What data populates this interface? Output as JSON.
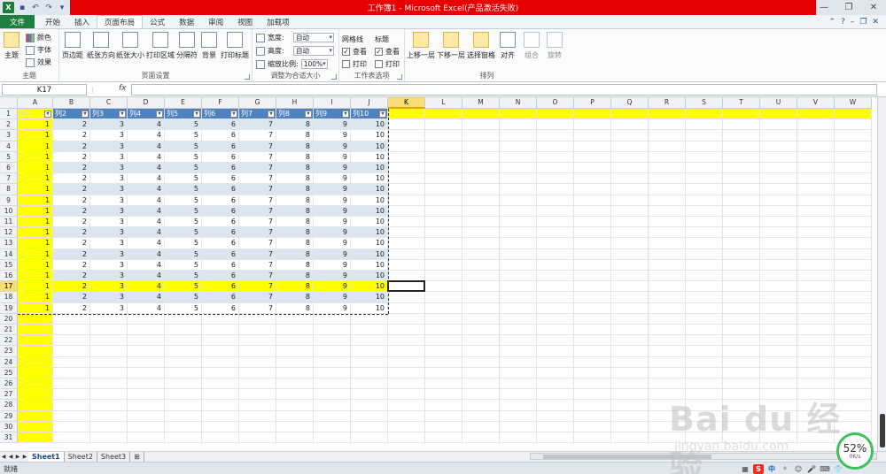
{
  "window": {
    "title": "工作簿1 - Microsoft Excel(产品激活失败)",
    "controls": [
      "—",
      "❐",
      "✕"
    ]
  },
  "quick_access": [
    "save-icon",
    "undo-icon",
    "redo-icon",
    "customize-icon"
  ],
  "tabs": [
    {
      "label": "文件",
      "kind": "file"
    },
    {
      "label": "开始"
    },
    {
      "label": "插入"
    },
    {
      "label": "页面布局",
      "active": true
    },
    {
      "label": "公式"
    },
    {
      "label": "数据"
    },
    {
      "label": "审阅"
    },
    {
      "label": "视图"
    },
    {
      "label": "加载项"
    }
  ],
  "ribbon": {
    "theme_group": {
      "label": "主题",
      "themes_btn": "主题",
      "colors": "颜色",
      "fonts": "字体",
      "effects": "效果"
    },
    "page_setup_group": {
      "label": "页面设置",
      "buttons": [
        "页边距",
        "纸张方向",
        "纸张大小",
        "打印区域",
        "分隔符",
        "背景",
        "打印标题"
      ]
    },
    "scale_group": {
      "label": "调整为合适大小",
      "width_label": "宽度:",
      "width_value": "自动",
      "height_label": "高度:",
      "height_value": "自动",
      "scale_label": "缩放比例:",
      "scale_value": "100%"
    },
    "sheet_options_group": {
      "label": "工作表选项",
      "gridlines_title": "网格线",
      "headings_title": "标题",
      "view": "查看",
      "print": "打印",
      "gridlines_view": true,
      "gridlines_print": false,
      "headings_view": true,
      "headings_print": false
    },
    "arrange_group": {
      "label": "排列",
      "buttons": [
        "上移一层",
        "下移一层",
        "选择窗格",
        "对齐",
        "组合",
        "旋转"
      ]
    }
  },
  "formula_bar": {
    "name_box": "K17",
    "fx": "fx",
    "value": ""
  },
  "grid": {
    "columns": [
      "A",
      "B",
      "C",
      "D",
      "E",
      "F",
      "G",
      "H",
      "I",
      "J",
      "K",
      "L",
      "M",
      "N",
      "O",
      "P",
      "Q",
      "R",
      "S",
      "T",
      "U",
      "V",
      "W"
    ],
    "active_column": "K",
    "active_row": 17,
    "header_row": [
      "列1",
      "列2",
      "列3",
      "列4",
      "列5",
      "列6",
      "列7",
      "列8",
      "列9",
      "列10"
    ],
    "data_values": [
      "1",
      "2",
      "3",
      "4",
      "5",
      "6",
      "7",
      "8",
      "9",
      "10"
    ],
    "data_row_count": 18,
    "total_rows": 31
  },
  "sheets": {
    "tabs": [
      "Sheet1",
      "Sheet2",
      "Sheet3"
    ],
    "active": "Sheet1"
  },
  "status": {
    "text": "就绪"
  },
  "speed_widget": {
    "percent": "52%",
    "rate": "0K/s"
  },
  "watermark": {
    "brand": "Bai du 经验",
    "url": "jingyan.baidu.com"
  },
  "tray": {
    "s": "S",
    "zh": "中"
  },
  "colors": {
    "title_red": "#e60000",
    "file_tab": "#1d7f3d",
    "table_header": "#4f81bd",
    "band": "#dce6f1",
    "highlight": "#ffff00"
  }
}
